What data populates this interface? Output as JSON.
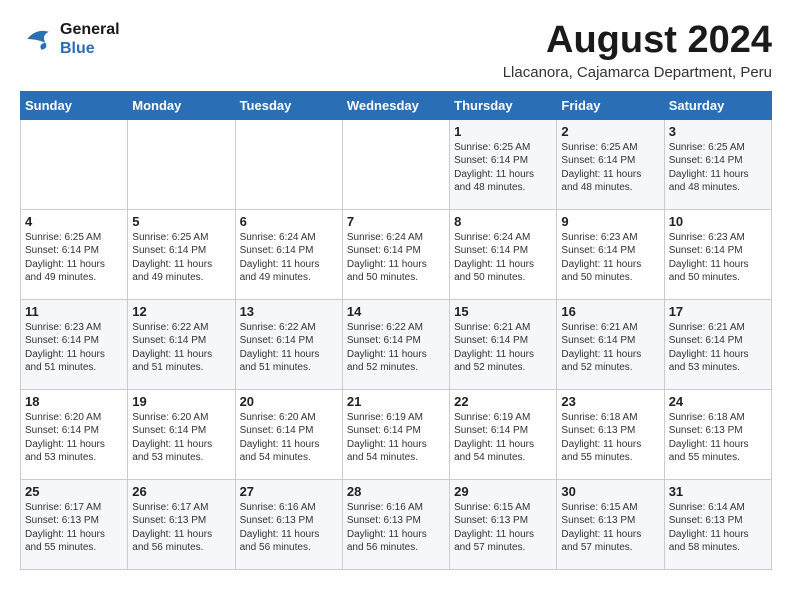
{
  "header": {
    "logo_line1": "General",
    "logo_line2": "Blue",
    "month_year": "August 2024",
    "location": "Llacanora, Cajamarca Department, Peru"
  },
  "weekdays": [
    "Sunday",
    "Monday",
    "Tuesday",
    "Wednesday",
    "Thursday",
    "Friday",
    "Saturday"
  ],
  "weeks": [
    [
      {
        "day": "",
        "text": ""
      },
      {
        "day": "",
        "text": ""
      },
      {
        "day": "",
        "text": ""
      },
      {
        "day": "",
        "text": ""
      },
      {
        "day": "1",
        "text": "Sunrise: 6:25 AM\nSunset: 6:14 PM\nDaylight: 11 hours\nand 48 minutes."
      },
      {
        "day": "2",
        "text": "Sunrise: 6:25 AM\nSunset: 6:14 PM\nDaylight: 11 hours\nand 48 minutes."
      },
      {
        "day": "3",
        "text": "Sunrise: 6:25 AM\nSunset: 6:14 PM\nDaylight: 11 hours\nand 48 minutes."
      }
    ],
    [
      {
        "day": "4",
        "text": "Sunrise: 6:25 AM\nSunset: 6:14 PM\nDaylight: 11 hours\nand 49 minutes."
      },
      {
        "day": "5",
        "text": "Sunrise: 6:25 AM\nSunset: 6:14 PM\nDaylight: 11 hours\nand 49 minutes."
      },
      {
        "day": "6",
        "text": "Sunrise: 6:24 AM\nSunset: 6:14 PM\nDaylight: 11 hours\nand 49 minutes."
      },
      {
        "day": "7",
        "text": "Sunrise: 6:24 AM\nSunset: 6:14 PM\nDaylight: 11 hours\nand 50 minutes."
      },
      {
        "day": "8",
        "text": "Sunrise: 6:24 AM\nSunset: 6:14 PM\nDaylight: 11 hours\nand 50 minutes."
      },
      {
        "day": "9",
        "text": "Sunrise: 6:23 AM\nSunset: 6:14 PM\nDaylight: 11 hours\nand 50 minutes."
      },
      {
        "day": "10",
        "text": "Sunrise: 6:23 AM\nSunset: 6:14 PM\nDaylight: 11 hours\nand 50 minutes."
      }
    ],
    [
      {
        "day": "11",
        "text": "Sunrise: 6:23 AM\nSunset: 6:14 PM\nDaylight: 11 hours\nand 51 minutes."
      },
      {
        "day": "12",
        "text": "Sunrise: 6:22 AM\nSunset: 6:14 PM\nDaylight: 11 hours\nand 51 minutes."
      },
      {
        "day": "13",
        "text": "Sunrise: 6:22 AM\nSunset: 6:14 PM\nDaylight: 11 hours\nand 51 minutes."
      },
      {
        "day": "14",
        "text": "Sunrise: 6:22 AM\nSunset: 6:14 PM\nDaylight: 11 hours\nand 52 minutes."
      },
      {
        "day": "15",
        "text": "Sunrise: 6:21 AM\nSunset: 6:14 PM\nDaylight: 11 hours\nand 52 minutes."
      },
      {
        "day": "16",
        "text": "Sunrise: 6:21 AM\nSunset: 6:14 PM\nDaylight: 11 hours\nand 52 minutes."
      },
      {
        "day": "17",
        "text": "Sunrise: 6:21 AM\nSunset: 6:14 PM\nDaylight: 11 hours\nand 53 minutes."
      }
    ],
    [
      {
        "day": "18",
        "text": "Sunrise: 6:20 AM\nSunset: 6:14 PM\nDaylight: 11 hours\nand 53 minutes."
      },
      {
        "day": "19",
        "text": "Sunrise: 6:20 AM\nSunset: 6:14 PM\nDaylight: 11 hours\nand 53 minutes."
      },
      {
        "day": "20",
        "text": "Sunrise: 6:20 AM\nSunset: 6:14 PM\nDaylight: 11 hours\nand 54 minutes."
      },
      {
        "day": "21",
        "text": "Sunrise: 6:19 AM\nSunset: 6:14 PM\nDaylight: 11 hours\nand 54 minutes."
      },
      {
        "day": "22",
        "text": "Sunrise: 6:19 AM\nSunset: 6:14 PM\nDaylight: 11 hours\nand 54 minutes."
      },
      {
        "day": "23",
        "text": "Sunrise: 6:18 AM\nSunset: 6:13 PM\nDaylight: 11 hours\nand 55 minutes."
      },
      {
        "day": "24",
        "text": "Sunrise: 6:18 AM\nSunset: 6:13 PM\nDaylight: 11 hours\nand 55 minutes."
      }
    ],
    [
      {
        "day": "25",
        "text": "Sunrise: 6:17 AM\nSunset: 6:13 PM\nDaylight: 11 hours\nand 55 minutes."
      },
      {
        "day": "26",
        "text": "Sunrise: 6:17 AM\nSunset: 6:13 PM\nDaylight: 11 hours\nand 56 minutes."
      },
      {
        "day": "27",
        "text": "Sunrise: 6:16 AM\nSunset: 6:13 PM\nDaylight: 11 hours\nand 56 minutes."
      },
      {
        "day": "28",
        "text": "Sunrise: 6:16 AM\nSunset: 6:13 PM\nDaylight: 11 hours\nand 56 minutes."
      },
      {
        "day": "29",
        "text": "Sunrise: 6:15 AM\nSunset: 6:13 PM\nDaylight: 11 hours\nand 57 minutes."
      },
      {
        "day": "30",
        "text": "Sunrise: 6:15 AM\nSunset: 6:13 PM\nDaylight: 11 hours\nand 57 minutes."
      },
      {
        "day": "31",
        "text": "Sunrise: 6:14 AM\nSunset: 6:13 PM\nDaylight: 11 hours\nand 58 minutes."
      }
    ]
  ]
}
